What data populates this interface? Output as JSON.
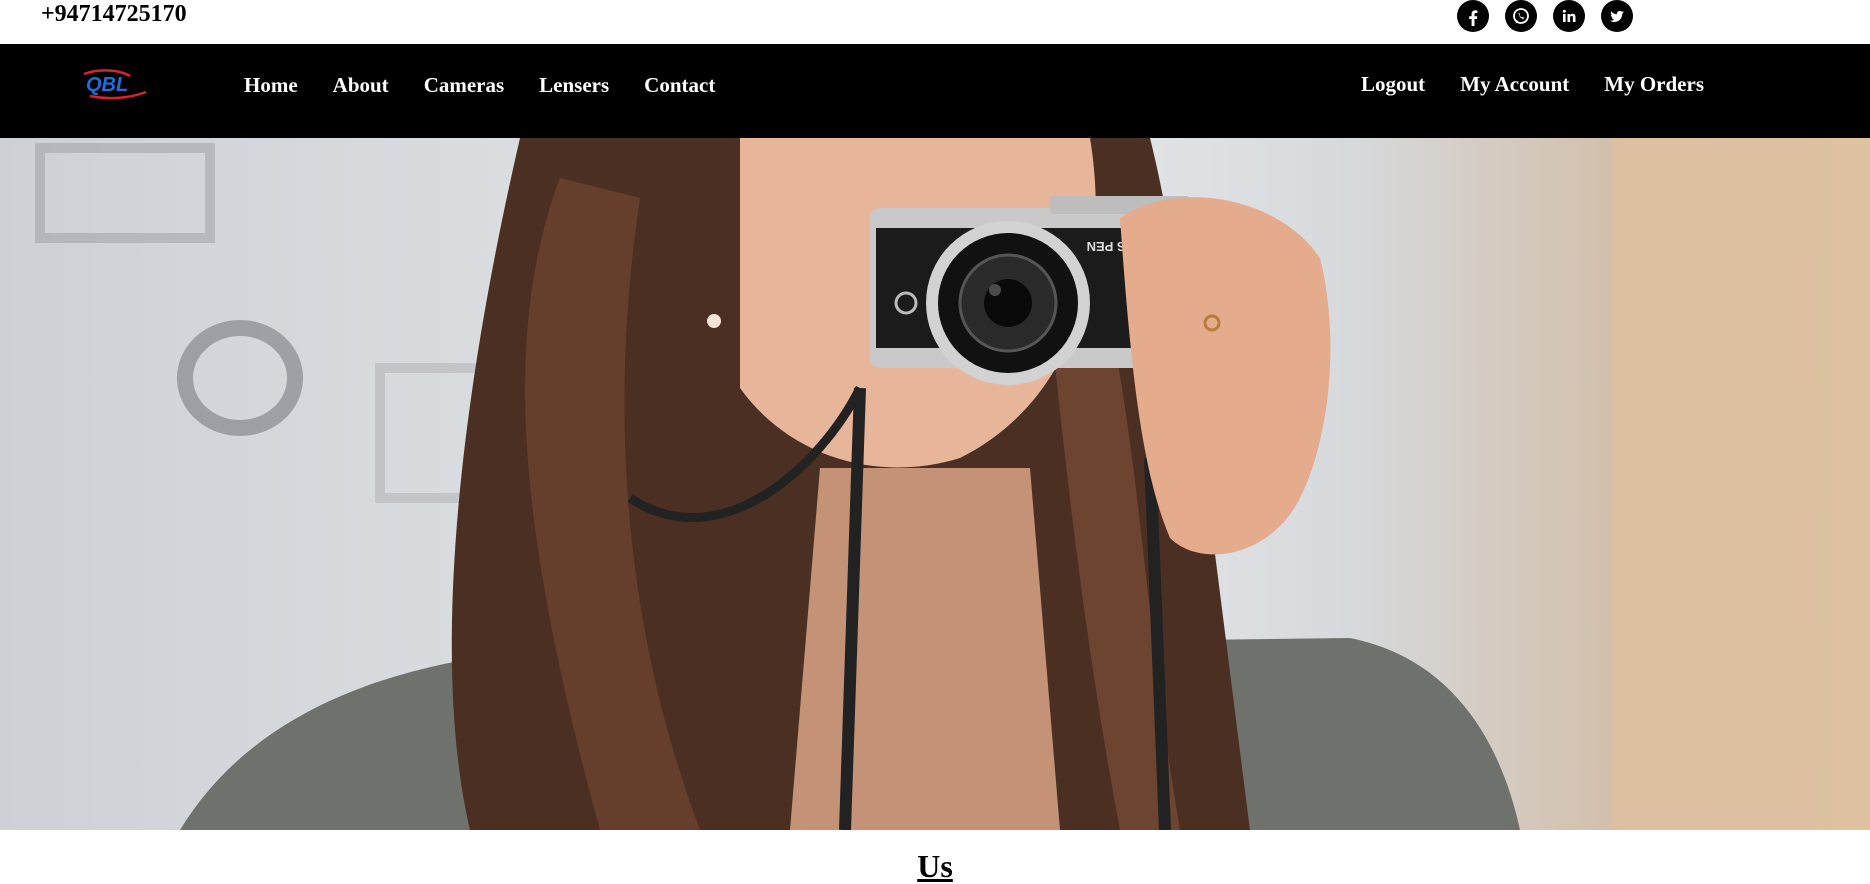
{
  "topbar": {
    "phone": "+94714725170",
    "social": [
      "facebook-icon",
      "whatsapp-icon",
      "linkedin-icon",
      "twitter-icon"
    ]
  },
  "nav": {
    "logo_text": "QBL",
    "left_links": [
      "Home",
      "About",
      "Cameras",
      "Lensers",
      "Contact"
    ],
    "right_links": [
      "Logout",
      "My Account",
      "My Orders"
    ]
  },
  "hero": {
    "camera_text": "US PEN"
  },
  "section": {
    "title": "Us"
  },
  "colors": {
    "nav_background": "#000000",
    "nav_text": "#ffffff",
    "logo_blue": "#1e6fd9",
    "logo_red": "#d9232e"
  }
}
